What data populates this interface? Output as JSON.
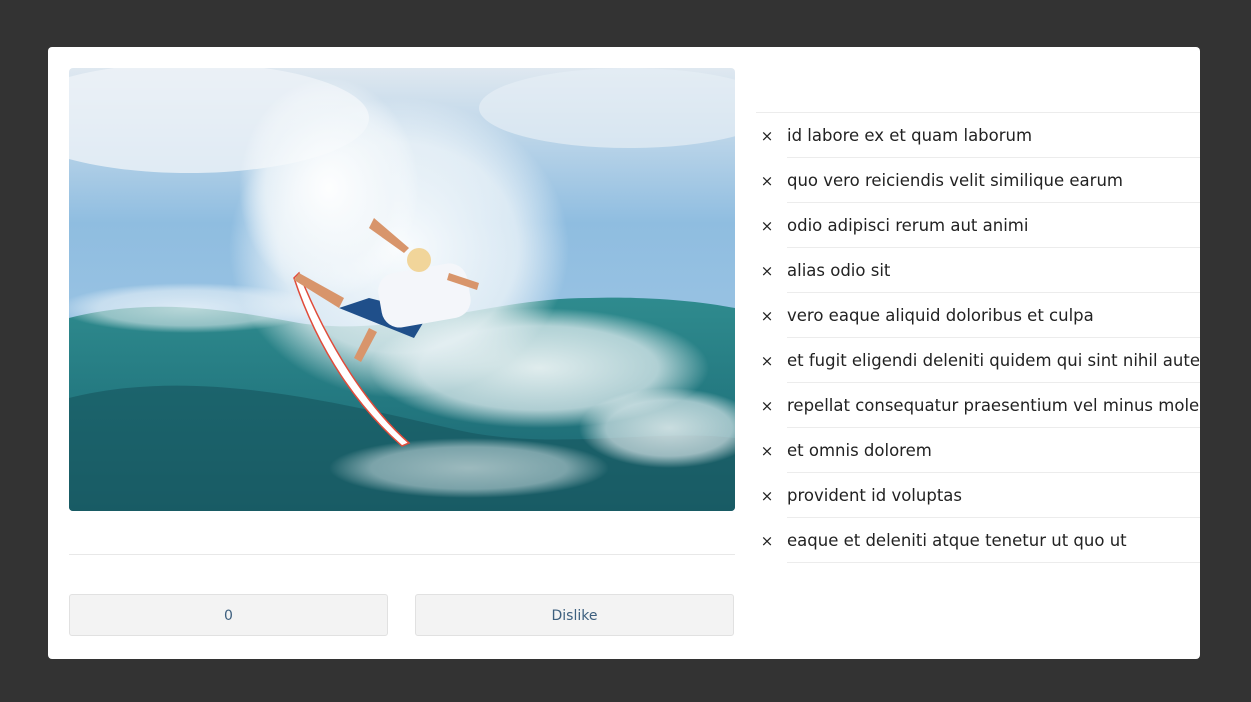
{
  "photo": {
    "alt": "Surfer riding a breaking wave",
    "colors": {
      "sky_top": "#7fb3d9",
      "sky_bottom": "#aacde8",
      "wave_dark": "#1d6f78",
      "wave_mid": "#2f8b8e",
      "spray": "#ffffff"
    }
  },
  "actions": {
    "like_label": "0",
    "dislike_label": "Dislike"
  },
  "comments": [
    {
      "text": "id labore ex et quam laborum",
      "remove_icon": "×"
    },
    {
      "text": "quo vero reiciendis velit similique earum",
      "remove_icon": "×"
    },
    {
      "text": "odio adipisci rerum aut animi",
      "remove_icon": "×"
    },
    {
      "text": "alias odio sit",
      "remove_icon": "×"
    },
    {
      "text": "vero eaque aliquid doloribus et culpa",
      "remove_icon": "×"
    },
    {
      "text": "et fugit eligendi deleniti quidem qui sint nihil autem",
      "remove_icon": "×"
    },
    {
      "text": "repellat consequatur praesentium vel minus molestias ut",
      "remove_icon": "×"
    },
    {
      "text": "et omnis dolorem",
      "remove_icon": "×"
    },
    {
      "text": "provident id voluptas",
      "remove_icon": "×"
    },
    {
      "text": "eaque et deleniti atque tenetur ut quo ut",
      "remove_icon": "×"
    }
  ]
}
